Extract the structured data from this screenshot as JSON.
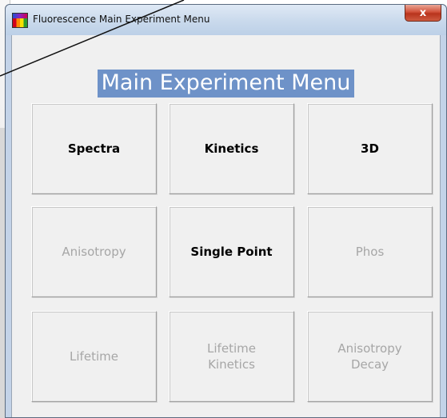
{
  "window": {
    "title": "Fluorescence Main Experiment Menu",
    "close_label": "x"
  },
  "menu": {
    "heading": "Main Experiment Menu",
    "buttons": [
      {
        "label": "Spectra",
        "enabled": true
      },
      {
        "label": "Kinetics",
        "enabled": true
      },
      {
        "label": "3D",
        "enabled": true
      },
      {
        "label": "Anisotropy",
        "enabled": false
      },
      {
        "label": "Single Point",
        "enabled": true
      },
      {
        "label": "Phos",
        "enabled": false
      },
      {
        "label": "Lifetime",
        "enabled": false
      },
      {
        "label": "Lifetime\nKinetics",
        "enabled": false
      },
      {
        "label": "Anisotropy\nDecay",
        "enabled": false
      }
    ]
  },
  "icons": {
    "app": "fluorescence-app-icon",
    "close": "close-icon"
  }
}
